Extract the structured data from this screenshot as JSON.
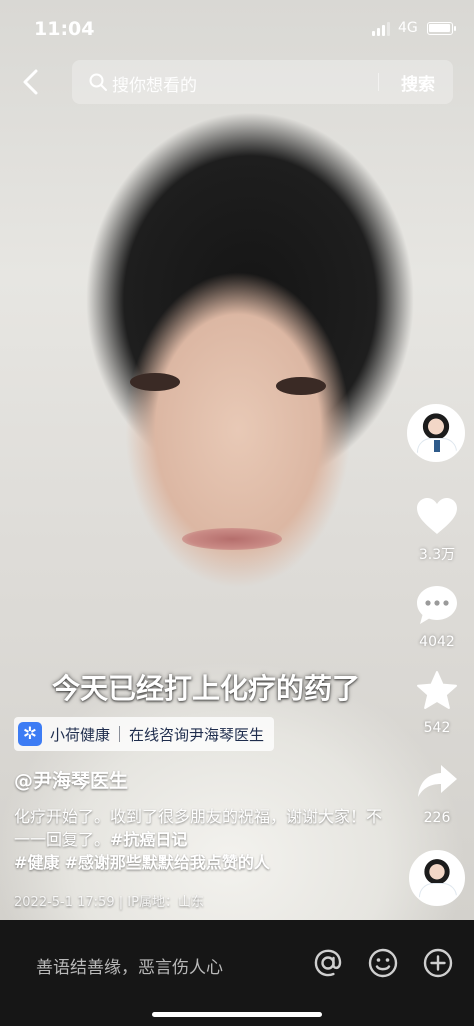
{
  "status_bar": {
    "time": "11:04",
    "network": "4G",
    "battery_level": 1.0
  },
  "header": {
    "search_placeholder": "搜你想看的",
    "search_button": "搜索"
  },
  "actions": {
    "like_count": "3.3万",
    "comment_count": "4042",
    "favorite_count": "542",
    "share_count": "226"
  },
  "video": {
    "subtitle": "今天已经打上化疗的药了"
  },
  "mini_app": {
    "name": "小荷健康",
    "description": "在线咨询尹海琴医生"
  },
  "post": {
    "author": "@尹海琴医生",
    "caption_text": "化疗开始了。收到了很多朋友的祝福，谢谢大家！不一一回复了。",
    "hashtags": [
      "#抗癌日记",
      "#健康",
      "#感谢那些默默给我点赞的人"
    ],
    "date": "2022-5-1 17:59",
    "ip_location": "IP属地：山东"
  },
  "comment_bar": {
    "placeholder": "善语结善缘，恶言伤人心"
  },
  "icons": {
    "back": "chevron-left-icon",
    "search": "search-icon",
    "like": "heart-icon",
    "comment": "speech-bubble-icon",
    "favorite": "star-icon",
    "share": "share-arrow-icon",
    "mention": "at-icon",
    "emoji": "smiley-icon",
    "add": "plus-circle-icon"
  },
  "colors": {
    "mini_app_icon": "#3d7cf4",
    "comment_bar_bg": "#161616"
  }
}
